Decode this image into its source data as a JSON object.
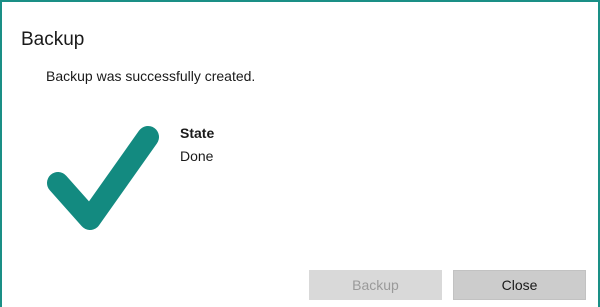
{
  "dialog": {
    "title": "Backup",
    "message": "Backup was successfully created.",
    "status_icon": "checkmark-icon",
    "state_label": "State",
    "state_value": "Done",
    "buttons": {
      "backup_label": "Backup",
      "backup_enabled": false,
      "close_label": "Close"
    }
  },
  "colors": {
    "accent": "#1a8f86",
    "checkmark": "#138a80"
  }
}
